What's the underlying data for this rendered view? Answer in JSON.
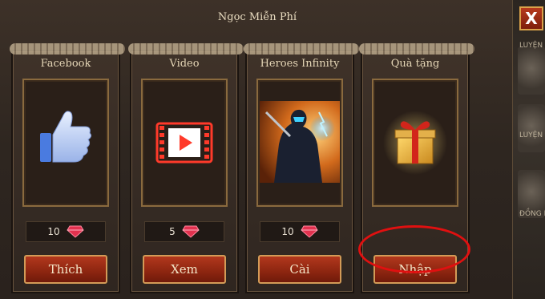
{
  "panel": {
    "title": "Ngọc Miễn Phí"
  },
  "close_label": "X",
  "side_labels": [
    "LUYỆN",
    "LUYỆN",
    "ĐỒNG H"
  ],
  "cards": [
    {
      "title": "Facebook",
      "icon": "thumbs-up-icon",
      "reward": "10",
      "action": "Thích"
    },
    {
      "title": "Video",
      "icon": "video-film-icon",
      "reward": "5",
      "action": "Xem"
    },
    {
      "title": "Heroes Infinity",
      "icon": "heroes-infinity-game-art",
      "reward": "10",
      "action": "Cài"
    },
    {
      "title": "Quà tặng",
      "icon": "gift-box-icon",
      "reward": "",
      "action": "Nhập"
    }
  ],
  "colors": {
    "accent_red": "#b2381d",
    "gem_red": "#e2324f",
    "highlight_circle": "#e01010"
  }
}
